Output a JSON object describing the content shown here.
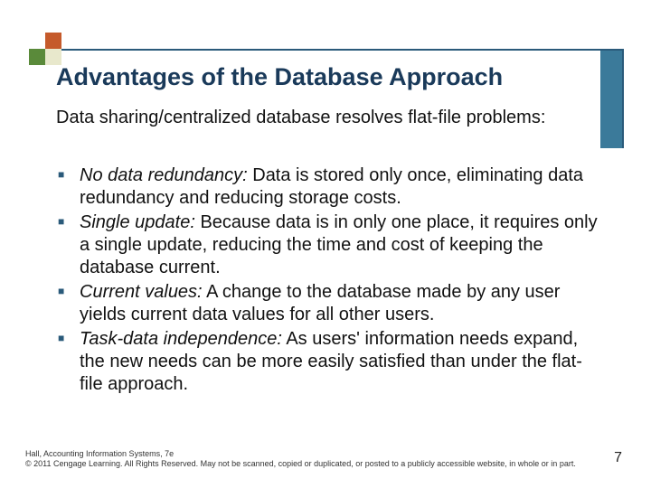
{
  "title": "Advantages of the Database Approach",
  "intro": "Data sharing/centralized database resolves flat-file problems:",
  "bullets": [
    {
      "term": "No data redundancy:",
      "text": " Data is stored only once, eliminating data redundancy and reducing storage costs."
    },
    {
      "term": "Single update:",
      "text": " Because data is in only one place, it requires only a single update, reducing the time and cost of keeping the database current."
    },
    {
      "term": "Current values:",
      "text": " A change to the database made by any user yields current data values for all other users."
    },
    {
      "term": "Task-data independence:",
      "text": " As users' information needs expand, the new needs can be more easily satisfied than under the flat-file approach."
    }
  ],
  "footer": {
    "line1": "Hall, Accounting Information Systems, 7e",
    "line2": "© 2011 Cengage Learning. All Rights Reserved. May not be scanned, copied or duplicated, or posted to a publicly accessible website, in whole or in part."
  },
  "page": "7"
}
